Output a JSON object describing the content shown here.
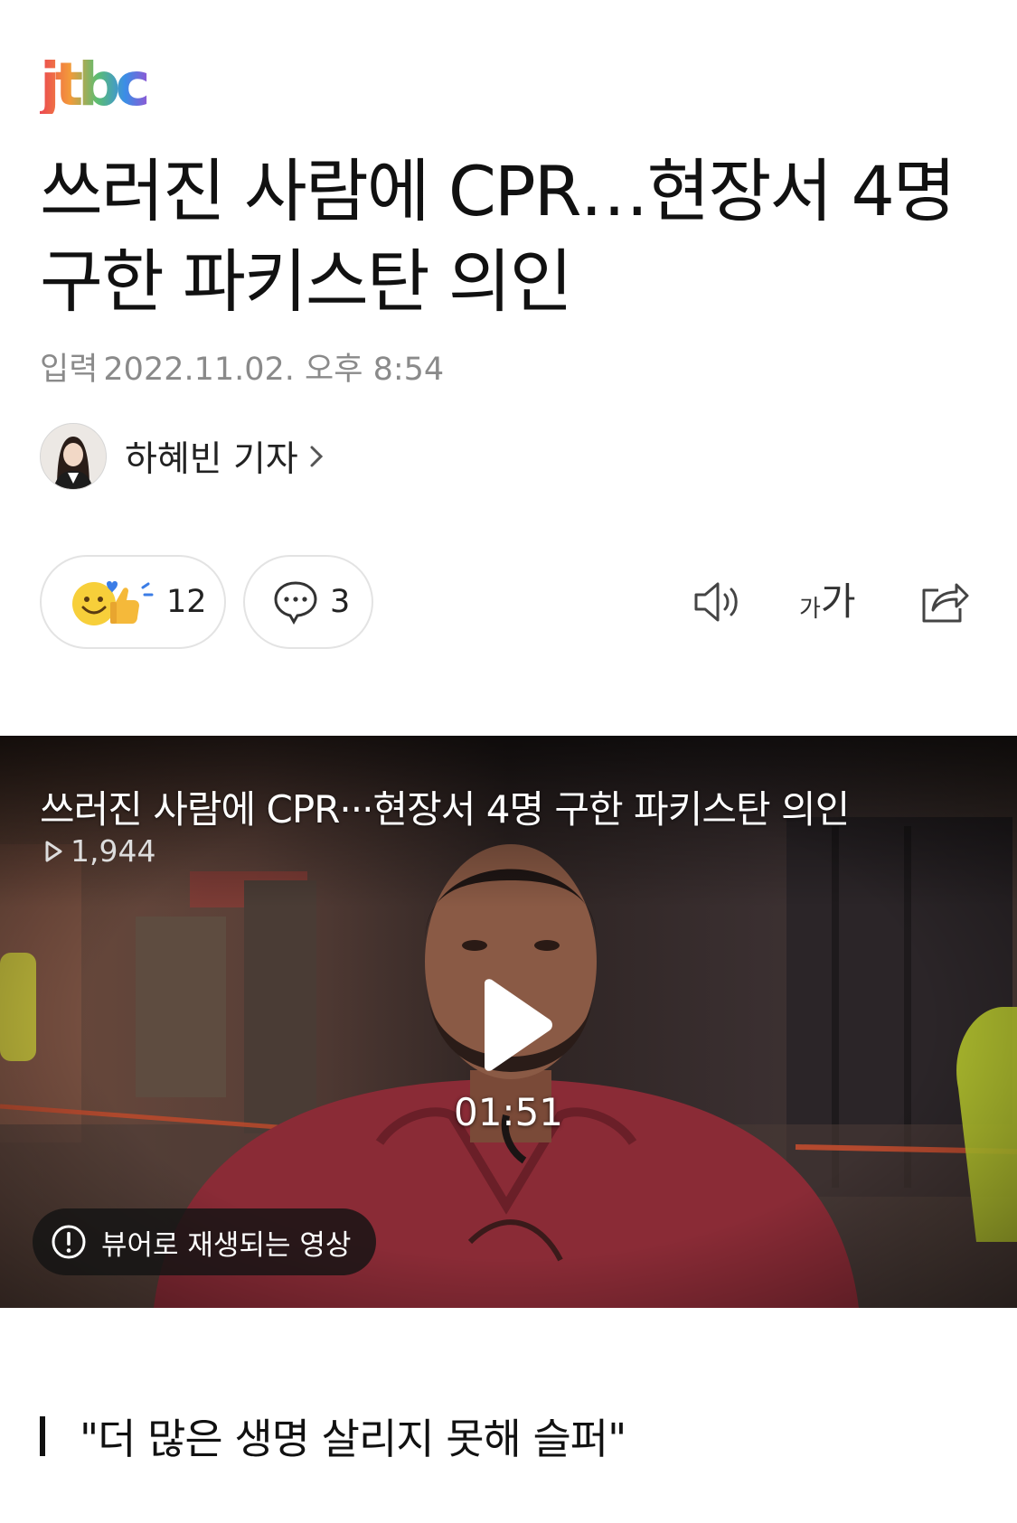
{
  "brand": {
    "logo_text": "jtbc"
  },
  "article": {
    "headline": "쓰러진 사람에 CPR…현장서 4명 구한 파키스탄 의인",
    "date_label": "입력",
    "date_value": "2022.11.02. 오후 8:54",
    "author_name": "하혜빈 기자",
    "subheading": "\"더 많은 생명 살리지 못해 슬퍼\""
  },
  "actions": {
    "reaction_count": "12",
    "comment_count": "3",
    "font_size_label_small": "가",
    "font_size_label_large": "가"
  },
  "video": {
    "title": "쓰러진 사람에 CPR···현장서 4명 구한 파키스탄 의인",
    "views": "1,944",
    "duration": "01:51",
    "viewer_notice": "뷰어로 재생되는 영상"
  },
  "icons": {
    "logo": "jtbc-logo",
    "avatar": "author-avatar",
    "chevron": "chevron-right-icon",
    "reaction": "reaction-emoji-icon",
    "comment": "comment-bubble-icon",
    "audio": "speaker-icon",
    "font": "font-size-icon",
    "share": "share-icon",
    "play": "play-icon",
    "info": "info-icon"
  },
  "colors": {
    "logo_j": "#e8433f",
    "logo_t": "#f2a23a",
    "logo_b": "#4cb06a",
    "logo_c": "#3d8fe0",
    "text_primary": "#111111",
    "text_secondary": "#8a8a8a"
  }
}
